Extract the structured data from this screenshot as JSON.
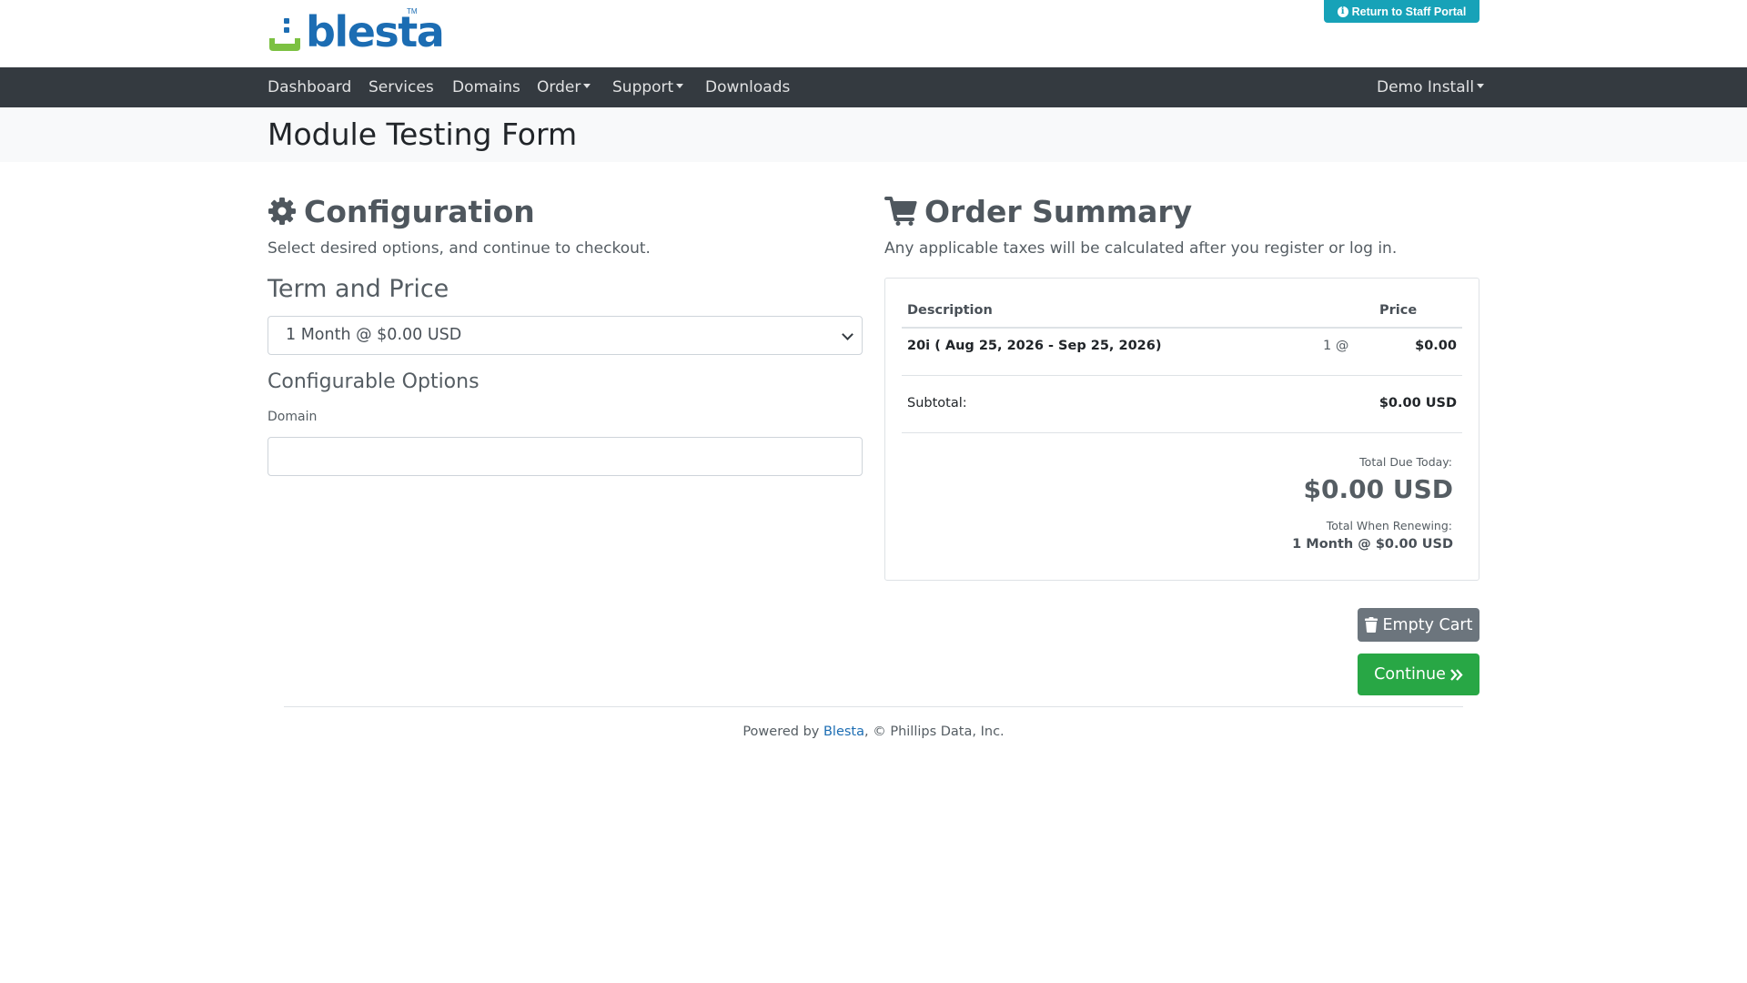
{
  "header": {
    "logo_text": "blesta",
    "logo_tm": "TM",
    "staff_button": "Return to Staff Portal"
  },
  "nav": {
    "items": [
      "Dashboard",
      "Services",
      "Domains",
      "Order",
      "Support",
      "Downloads"
    ],
    "account": "Demo Install"
  },
  "page": {
    "title": "Module Testing Form"
  },
  "configuration": {
    "heading": "Configuration",
    "subtitle": "Select desired options, and continue to checkout.",
    "term_heading": "Term and Price",
    "term_selected": "1 Month @ $0.00 USD",
    "options_heading": "Configurable Options",
    "domain_label": "Domain",
    "domain_value": ""
  },
  "summary": {
    "heading": "Order Summary",
    "subtitle": "Any applicable taxes will be calculated after you register or log in.",
    "col_description": "Description",
    "col_price": "Price",
    "item_description": "20i ( Aug 25, 2026 - Sep 25, 2026)",
    "item_qty": "1 @",
    "item_price": "$0.00",
    "subtotal_label": "Subtotal:",
    "subtotal_value": "$0.00 USD",
    "total_due_label": "Total Due Today:",
    "total_due_value": "$0.00 USD",
    "renew_label": "Total When Renewing:",
    "renew_value": "1 Month @ $0.00 USD"
  },
  "buttons": {
    "empty_cart": "Empty Cart",
    "continue": "Continue"
  },
  "footer": {
    "prefix": "Powered by ",
    "link": "Blesta",
    "suffix": ", © Phillips Data, Inc."
  },
  "colors": {
    "nav_bg": "#343a40",
    "brand_blue": "#1c6db3",
    "brand_green": "#7cc142",
    "info": "#17a2b8",
    "success": "#28a745",
    "secondary": "#6c757d"
  }
}
